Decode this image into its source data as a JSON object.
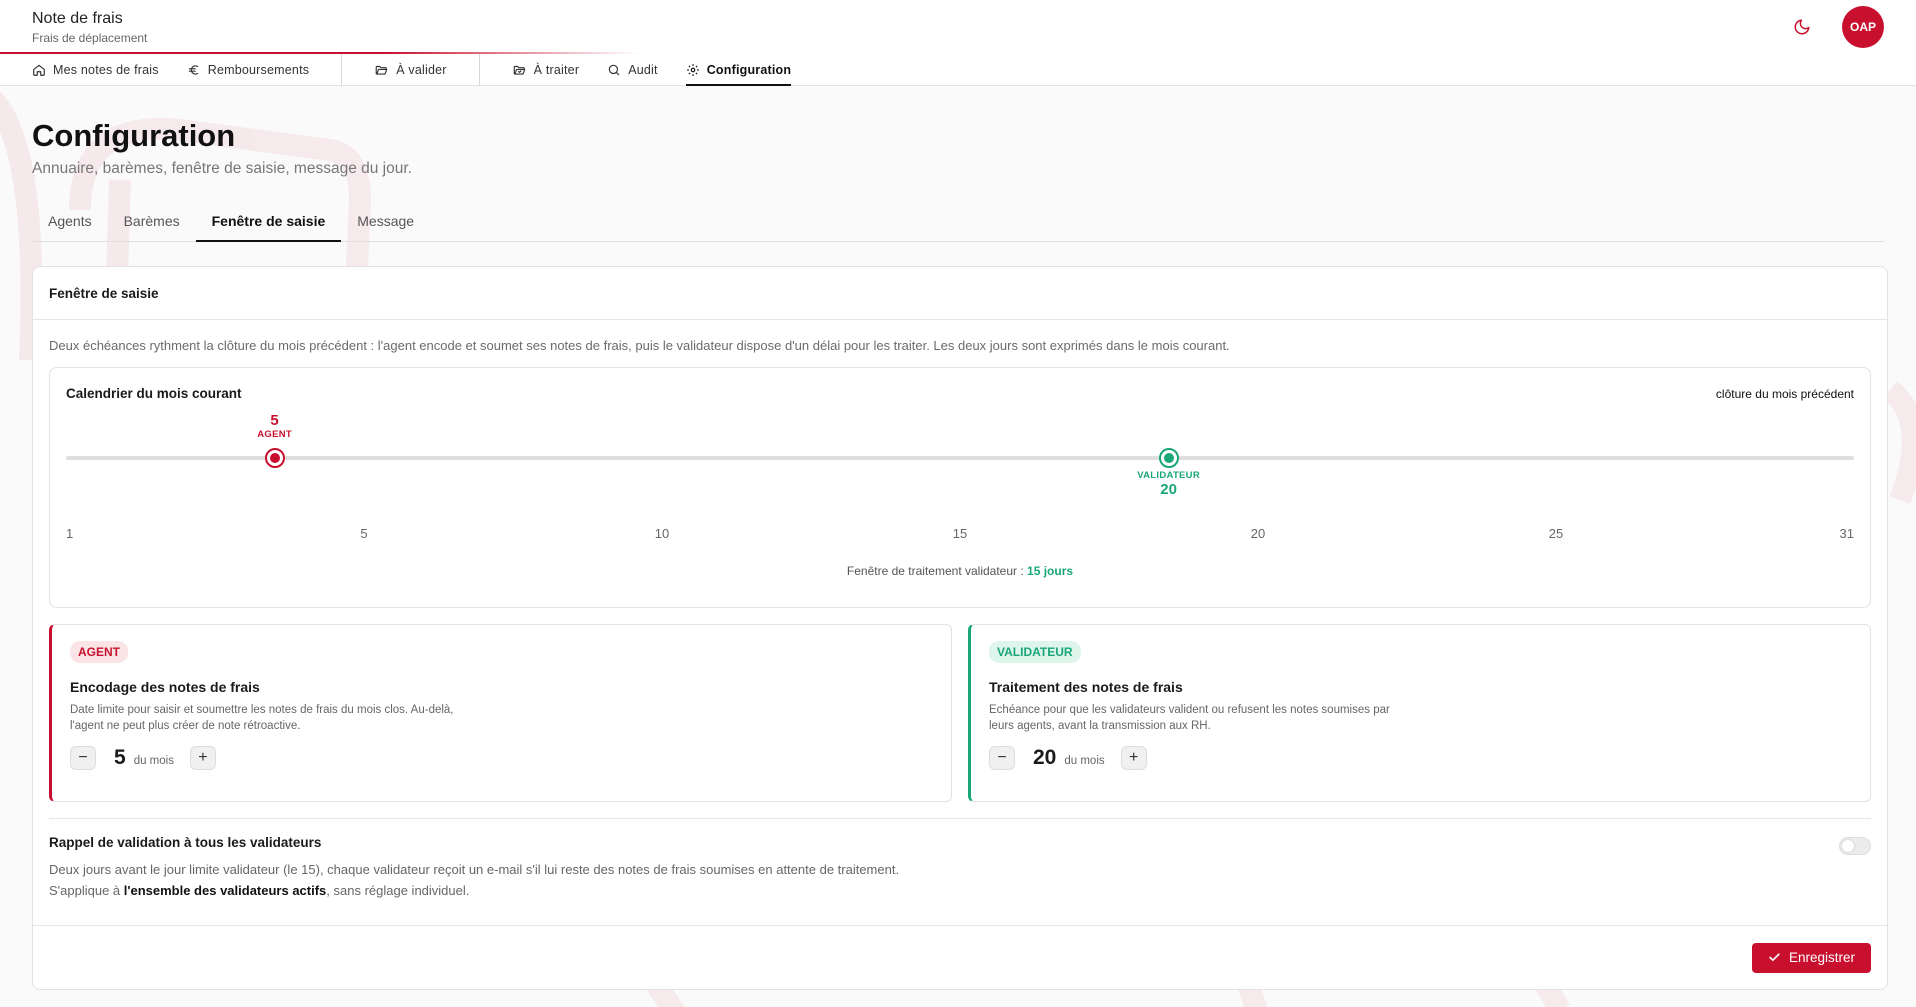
{
  "app": {
    "title": "Note de frais",
    "subtitle": "Frais de déplacement",
    "avatar_initials": "OAP"
  },
  "colors": {
    "brand": "#c8102e",
    "validator": "#1aa678"
  },
  "nav": {
    "items": [
      {
        "label": "Mes notes de frais",
        "icon": "home-icon"
      },
      {
        "label": "Remboursements",
        "icon": "euro-icon"
      },
      {
        "label": "À valider",
        "icon": "folder-open-icon"
      },
      {
        "label": "À traiter",
        "icon": "folder-check-icon"
      },
      {
        "label": "Audit",
        "icon": "search-icon"
      },
      {
        "label": "Configuration",
        "icon": "gear-icon",
        "active": true
      }
    ]
  },
  "page": {
    "title": "Configuration",
    "subtitle": "Annuaire, barèmes, fenêtre de saisie, message du jour."
  },
  "tabs": [
    "Agents",
    "Barèmes",
    "Fenêtre de saisie",
    "Message"
  ],
  "active_tab": "Fenêtre de saisie",
  "card": {
    "title": "Fenêtre de saisie",
    "description": "Deux échéances rythment la clôture du mois précédent : l'agent encode et soumet ses notes de frais, puis le validateur dispose d'un délai pour les traiter. Les deux jours sont exprimés dans le mois courant."
  },
  "calendar": {
    "title": "Calendrier du mois courant",
    "right_label": "clôture du mois précédent",
    "min_day": 1,
    "max_day": 31,
    "ticks": [
      "1",
      "5",
      "10",
      "15",
      "20",
      "25",
      "31"
    ],
    "agent_marker": {
      "day": 5,
      "label": "AGENT",
      "value": "5"
    },
    "validator_marker": {
      "day": 20,
      "label": "VALIDATEUR",
      "value": "20"
    },
    "window_prefix": "Fenêtre de traitement validateur :",
    "window_value": "15 jours"
  },
  "agent_card": {
    "badge": "AGENT",
    "title": "Encodage des notes de frais",
    "description": "Date limite pour saisir et soumettre les notes de frais du mois clos. Au-delà, l'agent ne peut plus créer de note rétroactive.",
    "value": "5",
    "unit": "du mois",
    "minus": "−",
    "plus": "+"
  },
  "validator_card": {
    "badge": "VALIDATEUR",
    "title": "Traitement des notes de frais",
    "description": "Echéance pour que les validateurs valident ou refusent les notes soumises par leurs agents, avant la transmission aux RH.",
    "value": "20",
    "unit": "du mois",
    "minus": "−",
    "plus": "+"
  },
  "reminder": {
    "title": "Rappel de validation à tous les validateurs",
    "line1": "Deux jours avant le jour limite validateur (le 15), chaque validateur reçoit un e-mail s'il lui reste des notes de frais soumises en attente de traitement.",
    "line2_prefix": "S'applique à ",
    "line2_bold": "l'ensemble des validateurs actifs",
    "line2_suffix": ", sans réglage individuel.",
    "enabled": false
  },
  "footer": {
    "save_label": "Enregistrer"
  }
}
